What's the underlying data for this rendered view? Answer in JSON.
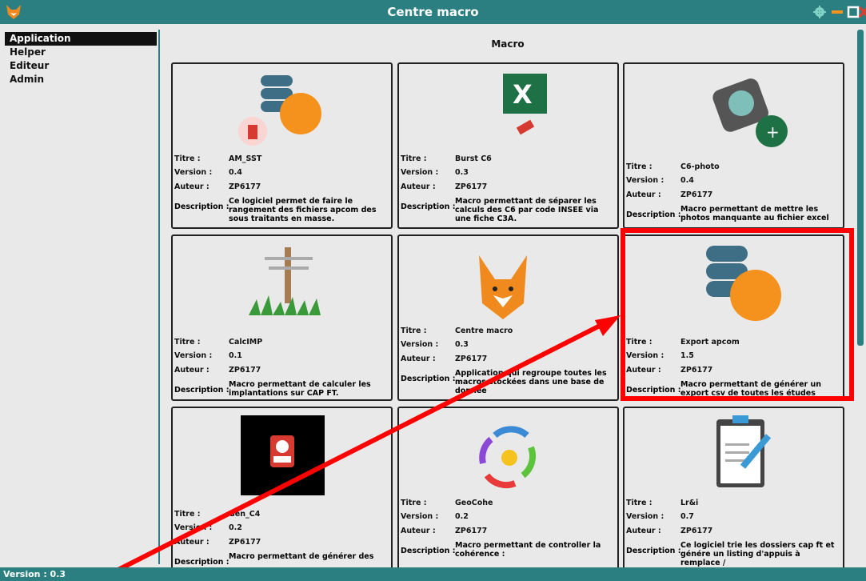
{
  "window": {
    "title": "Centre macro",
    "status": "Version : 0.3"
  },
  "sidebar": {
    "items": [
      {
        "label": "Application",
        "active": true
      },
      {
        "label": "Helper",
        "active": false
      },
      {
        "label": "Editeur",
        "active": false
      },
      {
        "label": "Admin",
        "active": false
      }
    ]
  },
  "main": {
    "heading": "Macro"
  },
  "fields": {
    "title": "Titre :",
    "version": "Version :",
    "author": "Auteur :",
    "description": "Description :"
  },
  "cards": [
    {
      "title": "AM_SST",
      "version": "0.4",
      "author": "ZP6177",
      "description": "Ce logiciel permet de faire le rangement des fichiers apcom des sous traitants en masse.",
      "icon": "database-orange-fist-icon"
    },
    {
      "title": "Burst C6",
      "version": "0.3",
      "author": "ZP6177",
      "description": "Macro permettant de séparer les calculs des C6 par code INSEE via une fiche C3A.",
      "icon": "excel-firecracker-icon"
    },
    {
      "title": "C6-photo",
      "version": "0.4",
      "author": "ZP6177",
      "description": "Macro permettant de mettre les photos manquante au fichier excel",
      "icon": "camera-excel-icon"
    },
    {
      "title": "CalcIMP",
      "version": "0.1",
      "author": "ZP6177",
      "description": "Macro permettant de calculer les implantations sur CAP FT.",
      "icon": "pole-grass-icon"
    },
    {
      "title": "Centre macro",
      "version": "0.3",
      "author": "ZP6177",
      "description": "Application qui regroupe toutes les macros stockées dans une base de donnée",
      "icon": "fox-icon"
    },
    {
      "title": "Export apcom",
      "version": "1.5",
      "author": "ZP6177",
      "description": "Macro permettant de générer un export csv de toutes les études réalisées",
      "icon": "database-orange-icon"
    },
    {
      "title": "Gen_C4",
      "version": "0.2",
      "author": "ZP6177",
      "description": "Macro permettant de générer des",
      "icon": "timer-bomb-icon"
    },
    {
      "title": "GeoCohe",
      "version": "0.2",
      "author": "ZP6177",
      "description": "Macro permettant de controller la cohérence :",
      "icon": "cycle-arrows-icon"
    },
    {
      "title": "Lr&i",
      "version": "0.7",
      "author": "ZP6177",
      "description": "Ce logiciel trie les dossiers cap ft et génére un listing d'appuis à remplace /",
      "icon": "clipboard-pen-icon"
    }
  ],
  "colors": {
    "accent": "#2b7f80",
    "highlight": "#ff0000",
    "orange": "#f5921e",
    "db": "#3d6e86"
  }
}
